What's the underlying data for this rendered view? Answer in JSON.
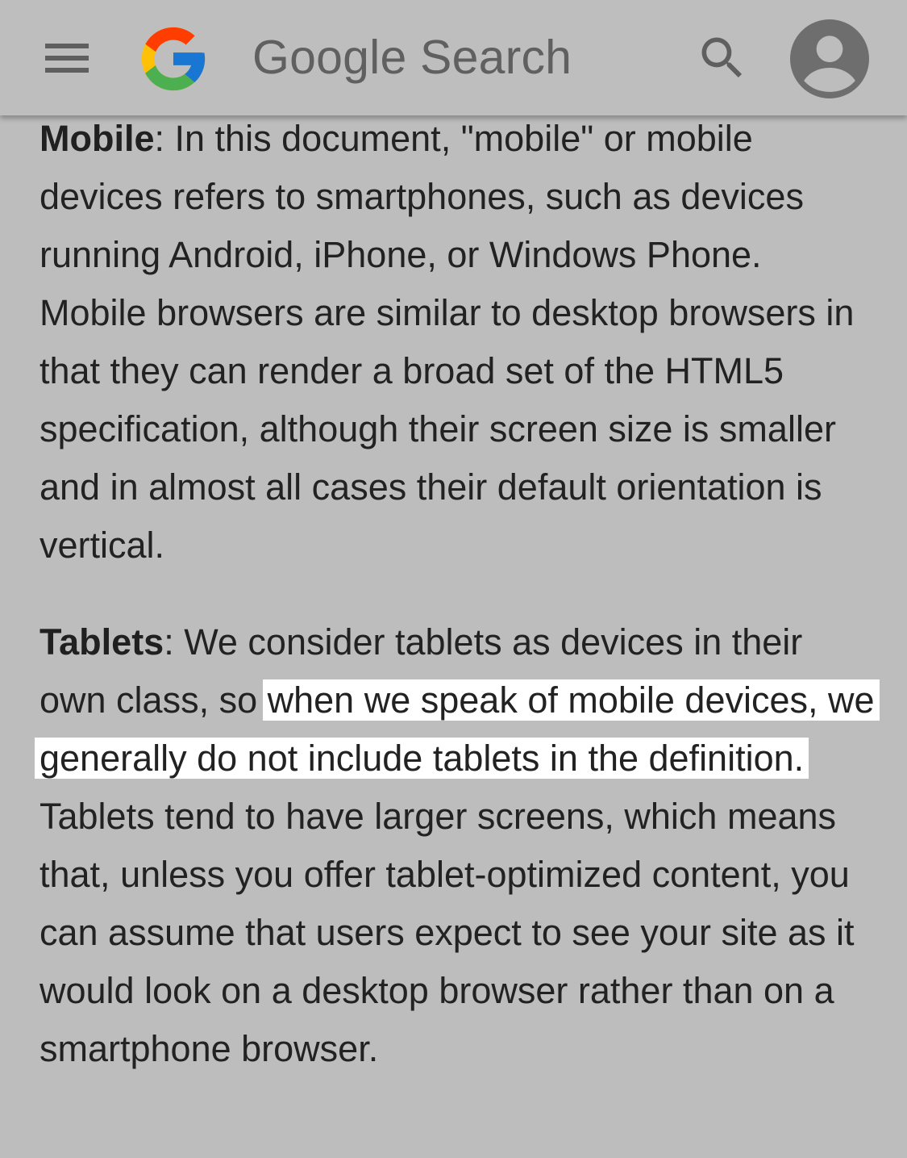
{
  "app_bar": {
    "title": "Google Search",
    "menu_icon": "hamburger-menu-icon",
    "logo_icon": "google-g-logo",
    "search_icon": "search-icon",
    "account_icon": "account-circle-icon",
    "logo_colors": {
      "red": "#EA4335",
      "yellow": "#FBBC05",
      "green": "#34A853",
      "blue": "#4285F4"
    },
    "background": "#bebebe"
  },
  "content": {
    "paragraphs": [
      {
        "term": "Mobile",
        "text": ": In this document, \"mobile\" or mobile devices refers to smartphones, such as devices running Android, iPhone, or Windows Phone. Mobile browsers are similar to desktop browsers in that they can render a broad set of the HTML5 specification, although their screen size is smaller and in almost all cases their default orientation is vertical."
      },
      {
        "term": "Tablets",
        "text_before": ": We consider tablets as devices in their own class, so ",
        "highlighted": "when we speak of mobile devices, we generally do not include tablets in the definition.",
        "text_after": " Tablets tend to have larger screens, which means that, unless you offer tablet-optimized content, you can assume that users expect to see your site as it would look on a desktop browser rather than on a smartphone browser."
      }
    ],
    "highlight_color": "#ffffff",
    "page_background": "#bdbdbd"
  }
}
